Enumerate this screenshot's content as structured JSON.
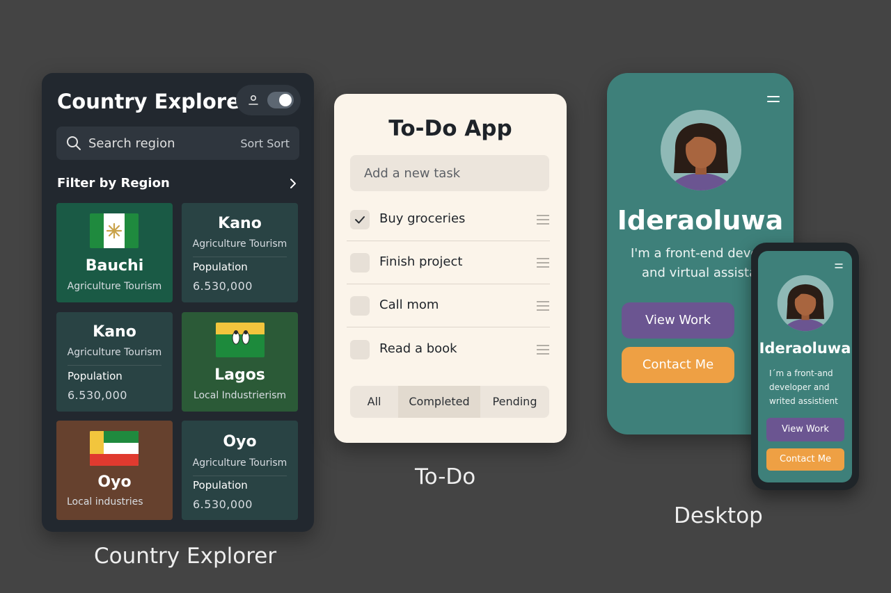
{
  "country_explorer": {
    "title": "Country Explorer",
    "search_placeholder": "Search region",
    "sort_label": "Sort Sort",
    "filter_label": "Filter by Region",
    "cards": [
      {
        "name": "Bauchi",
        "subtitle": "Agriculture Tourism",
        "color": "#1a5a45"
      },
      {
        "name": "Kano",
        "subtitle": "Agriculture Tourism",
        "population_label": "Population",
        "population": "6.530,000",
        "color": "#294344"
      },
      {
        "name": "Kano",
        "subtitle": "Agriculture Tourism",
        "population_label": "Population",
        "population": "6.530,000",
        "color": "#294344"
      },
      {
        "name": "Lagos",
        "subtitle": "Local Industrierism",
        "color": "#2b5a37"
      },
      {
        "name": "Oyo",
        "subtitle": "Local industries",
        "color": "#66412e"
      },
      {
        "name": "Oyo",
        "subtitle": "Agriculture Tourism",
        "population_label": "Population",
        "population": "6.530,000",
        "color": "#294344"
      }
    ],
    "caption": "Country Explorer"
  },
  "todo": {
    "title": "To-Do App",
    "input_placeholder": "Add a new task",
    "tasks": [
      {
        "label": "Buy groceries",
        "done": true
      },
      {
        "label": "Finish project",
        "done": false
      },
      {
        "label": "Call mom",
        "done": false
      },
      {
        "label": "Read a book",
        "done": false
      }
    ],
    "filters": [
      "All",
      "Completed",
      "Pending"
    ],
    "active_filter": "All",
    "caption": "To-Do"
  },
  "portfolio": {
    "name": "Ideraoluwa",
    "tagline_line1": "I'm a front-end developer",
    "tagline_line2": "and virtual assistant",
    "view_work": "View Work",
    "contact": "Contact Me",
    "caption": "Desktop",
    "mobile": {
      "name": "Ideraoluwa",
      "tagline": "I´m a front-and developer and writed assistient",
      "view_work": "View Work",
      "contact": "Contact Me"
    },
    "colors": {
      "teal": "#3e807a",
      "purple": "#6b5591",
      "orange": "#eea044"
    }
  }
}
